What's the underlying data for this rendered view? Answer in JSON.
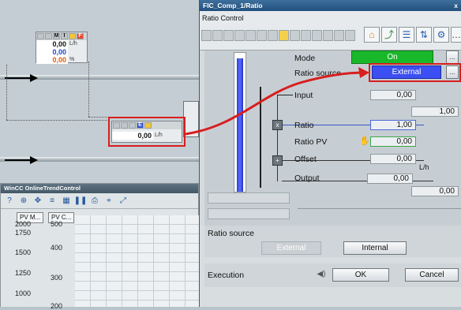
{
  "process": {
    "mini_top": {
      "flags": [
        "M",
        "I",
        "F"
      ],
      "value1": "0,00",
      "unit1": "L/h",
      "value2": "0,00",
      "value3": "0,00",
      "unit3": "%"
    },
    "mini_mid": {
      "flags": [
        "E"
      ],
      "value": "0,00",
      "unit": "L/h"
    }
  },
  "trend": {
    "title": "WinCC OnlineTrendControl",
    "tab1": "PV M...",
    "tab2": "PV C...",
    "axis1": [
      "2000",
      "1750",
      "1500",
      "1250",
      "1000"
    ],
    "axis2": [
      "500",
      "400",
      "300",
      "200"
    ]
  },
  "faceplate": {
    "title": "FIC_Comp_1/Ratio",
    "close": "x",
    "header_label": "Ratio Control",
    "mode_label": "Mode",
    "mode_value": "On",
    "ratio_source_label": "Ratio source",
    "ratio_source_value": "External",
    "more": "...",
    "input_label": "Input",
    "input_value": "0,00",
    "input_scale": "1,00",
    "op_x": "x",
    "op_plus": "+",
    "ratio_label": "Ratio",
    "ratio_value": "1,00",
    "ratio_pv_label": "Ratio PV",
    "ratio_pv_value": "0,00",
    "offset_label": "Offset",
    "offset_value": "0,00",
    "offset_unit": "L/h",
    "output_label": "Output",
    "output_value": "0,00",
    "output_scale": "0,00",
    "bar_fill_percent": 96,
    "bottom": {
      "panel_label": "Ratio source",
      "btn_external": "External",
      "btn_internal": "Internal",
      "exec_label": "Execution",
      "ok": "OK",
      "cancel": "Cancel"
    }
  },
  "colors": {
    "mode_on": "#19b82a",
    "ratio_source": "#3c4ff2",
    "highlight": "#d81e1e"
  }
}
